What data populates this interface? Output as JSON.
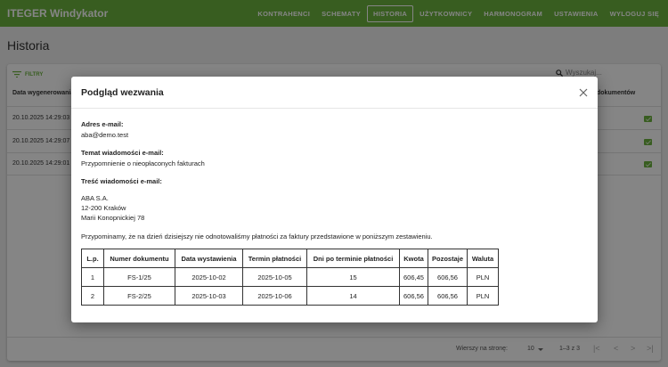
{
  "app": {
    "title": "ITEGER Windykator"
  },
  "nav": {
    "items": [
      {
        "label": "KONTRAHENCI",
        "active": false
      },
      {
        "label": "SCHEMATY",
        "active": false
      },
      {
        "label": "HISTORIA",
        "active": true
      },
      {
        "label": "UŻYTKOWNICY",
        "active": false
      },
      {
        "label": "HARMONOGRAM",
        "active": false
      },
      {
        "label": "USTAWIENIA",
        "active": false
      },
      {
        "label": "WYLOGUJ SIĘ",
        "active": false
      }
    ]
  },
  "page": {
    "title": "Historia"
  },
  "toolbar": {
    "filter_label": "FILTRY",
    "search_placeholder": "Wyszukaj..."
  },
  "table": {
    "columns": [
      "Data wygenerowania",
      "dokumentów"
    ],
    "rows": [
      {
        "date": "20.10.2025 14:29:03"
      },
      {
        "date": "20.10.2025 14:29:07"
      },
      {
        "date": "20.10.2025 14:29:01"
      }
    ]
  },
  "pagination": {
    "rows_per_page_label": "Wierszy na stronę:",
    "rows_per_page_value": "10",
    "range": "1–3 z 3",
    "icons": [
      "first-page-icon",
      "prev-page-icon",
      "next-page-icon",
      "last-page-icon"
    ]
  },
  "modal": {
    "title": "Podgląd wezwania",
    "email_label": "Adres e-mail:",
    "email_value": "aba@demo.test",
    "subject_label": "Temat wiadomości e-mail:",
    "subject_value": "Przypomnienie o nieopłaconych fakturach",
    "body_label": "Treść wiadomości e-mail:",
    "address": [
      "ABA S.A.",
      "12-200 Kraków",
      "Marii Konopnickiej 78"
    ],
    "paragraph": "Przypominamy, że na dzień dzisiejszy nie odnotowaliśmy płatności za faktury przedstawione w poniższym zestawieniu.",
    "invoice_table": {
      "headers": [
        "L.p.",
        "Numer dokumentu",
        "Data wystawienia",
        "Termin płatności",
        "Dni po terminie płatności",
        "Kwota",
        "Pozostaje",
        "Waluta"
      ],
      "rows": [
        [
          "1",
          "FS-1/25",
          "2025-10-02",
          "2025-10-05",
          "15",
          "606,45",
          "606,56",
          "PLN"
        ],
        [
          "2",
          "FS-2/25",
          "2025-10-03",
          "2025-10-06",
          "14",
          "606,56",
          "606,56",
          "PLN"
        ]
      ]
    }
  },
  "colors": {
    "accent": "#6cb33f",
    "overlay": "#000000"
  }
}
